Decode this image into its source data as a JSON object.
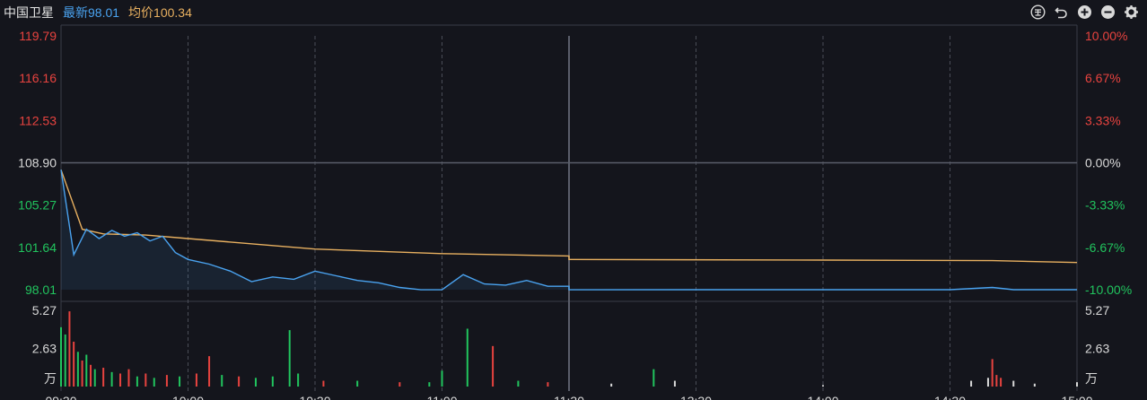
{
  "header": {
    "stock_name": "中国卫星",
    "latest_text": "最新98.01",
    "avg_text": "均价100.34"
  },
  "toolbar": [
    "history-icon",
    "undo-icon",
    "zoom-in-icon",
    "zoom-out-icon",
    "settings-icon"
  ],
  "colors": {
    "up": "#e8433f",
    "down": "#21c45e",
    "neutral": "#d9d9d9",
    "price_line": "#4aa3f0",
    "avg_line": "#e8b060",
    "background": "#14151c",
    "grid": "#3a3d47"
  },
  "chart_data": [
    {
      "type": "line",
      "series": [
        {
          "name": "最新",
          "x": [
            "09:30",
            "09:33",
            "09:36",
            "09:39",
            "09:42",
            "09:45",
            "09:48",
            "09:51",
            "09:54",
            "09:57",
            "10:00",
            "10:05",
            "10:10",
            "10:15",
            "10:20",
            "10:25",
            "10:30",
            "10:35",
            "10:40",
            "10:45",
            "10:50",
            "10:55",
            "11:00",
            "11:05",
            "11:10",
            "11:15",
            "11:20",
            "11:25",
            "11:30",
            "13:00",
            "13:30",
            "14:00",
            "14:30",
            "14:40",
            "14:45",
            "15:00"
          ],
          "values": [
            108.3,
            101.0,
            103.2,
            102.4,
            103.1,
            102.6,
            102.9,
            102.2,
            102.6,
            101.2,
            100.6,
            100.2,
            99.6,
            98.7,
            99.1,
            98.9,
            99.6,
            99.2,
            98.8,
            98.6,
            98.2,
            98.0,
            98.0,
            99.3,
            98.5,
            98.4,
            98.8,
            98.3,
            98.3,
            98.0,
            98.01,
            98.01,
            98.01,
            98.2,
            98.01,
            98.01
          ]
        },
        {
          "name": "均价",
          "x": [
            "09:30",
            "09:35",
            "09:40",
            "09:50",
            "10:00",
            "10:20",
            "10:30",
            "11:00",
            "11:30",
            "13:00",
            "14:00",
            "14:40",
            "15:00"
          ],
          "values": [
            108.3,
            103.2,
            102.8,
            102.7,
            102.4,
            101.8,
            101.5,
            101.1,
            100.9,
            100.6,
            100.55,
            100.5,
            100.34
          ]
        }
      ],
      "ylabel_left": [
        "119.79",
        "116.16",
        "112.53",
        "108.90",
        "105.27",
        "101.64",
        "98.01"
      ],
      "ylabel_right": [
        "10.00%",
        "6.67%",
        "3.33%",
        "0.00%",
        "-3.33%",
        "-6.67%",
        "-10.00%"
      ],
      "ylim": [
        98.01,
        119.79
      ],
      "prev_close": 108.9
    },
    {
      "type": "bar",
      "unit_label": "万",
      "ylabel_left": [
        "5.27",
        "2.63"
      ],
      "ylabel_right": [
        "5.27",
        "2.63"
      ],
      "ylim": [
        0,
        5.27
      ],
      "x_ticks": [
        "09:30",
        "10:00",
        "10:30",
        "11:00",
        "11:30",
        "13:30",
        "14:00",
        "14:30",
        "15:00"
      ],
      "bars": [
        {
          "t": "09:30",
          "v": 4.1,
          "d": "down"
        },
        {
          "t": "09:31",
          "v": 3.6,
          "d": "down"
        },
        {
          "t": "09:32",
          "v": 5.2,
          "d": "up"
        },
        {
          "t": "09:33",
          "v": 3.1,
          "d": "up"
        },
        {
          "t": "09:34",
          "v": 2.4,
          "d": "down"
        },
        {
          "t": "09:35",
          "v": 1.8,
          "d": "up"
        },
        {
          "t": "09:36",
          "v": 2.2,
          "d": "down"
        },
        {
          "t": "09:37",
          "v": 1.5,
          "d": "up"
        },
        {
          "t": "09:38",
          "v": 1.2,
          "d": "down"
        },
        {
          "t": "09:40",
          "v": 1.3,
          "d": "up"
        },
        {
          "t": "09:42",
          "v": 1.0,
          "d": "down"
        },
        {
          "t": "09:44",
          "v": 0.9,
          "d": "up"
        },
        {
          "t": "09:46",
          "v": 1.2,
          "d": "up"
        },
        {
          "t": "09:48",
          "v": 0.7,
          "d": "down"
        },
        {
          "t": "09:50",
          "v": 0.9,
          "d": "up"
        },
        {
          "t": "09:52",
          "v": 0.6,
          "d": "down"
        },
        {
          "t": "09:55",
          "v": 0.8,
          "d": "up"
        },
        {
          "t": "09:58",
          "v": 0.7,
          "d": "down"
        },
        {
          "t": "10:02",
          "v": 0.9,
          "d": "up"
        },
        {
          "t": "10:05",
          "v": 2.1,
          "d": "up"
        },
        {
          "t": "10:08",
          "v": 0.8,
          "d": "down"
        },
        {
          "t": "10:12",
          "v": 0.7,
          "d": "up"
        },
        {
          "t": "10:16",
          "v": 0.6,
          "d": "down"
        },
        {
          "t": "10:20",
          "v": 0.7,
          "d": "down"
        },
        {
          "t": "10:24",
          "v": 3.9,
          "d": "down"
        },
        {
          "t": "10:26",
          "v": 0.9,
          "d": "down"
        },
        {
          "t": "10:32",
          "v": 0.4,
          "d": "up"
        },
        {
          "t": "10:40",
          "v": 0.4,
          "d": "down"
        },
        {
          "t": "10:50",
          "v": 0.3,
          "d": "up"
        },
        {
          "t": "10:57",
          "v": 0.3,
          "d": "down"
        },
        {
          "t": "11:00",
          "v": 1.1,
          "d": "down"
        },
        {
          "t": "11:06",
          "v": 4.0,
          "d": "down"
        },
        {
          "t": "11:12",
          "v": 2.8,
          "d": "up"
        },
        {
          "t": "11:18",
          "v": 0.4,
          "d": "down"
        },
        {
          "t": "11:25",
          "v": 0.3,
          "d": "up"
        },
        {
          "t": "13:10",
          "v": 0.2,
          "d": "neutral"
        },
        {
          "t": "13:20",
          "v": 1.2,
          "d": "down"
        },
        {
          "t": "13:25",
          "v": 0.4,
          "d": "neutral"
        },
        {
          "t": "14:00",
          "v": 0.1,
          "d": "neutral"
        },
        {
          "t": "14:35",
          "v": 0.4,
          "d": "neutral"
        },
        {
          "t": "14:39",
          "v": 0.6,
          "d": "neutral"
        },
        {
          "t": "14:40",
          "v": 1.9,
          "d": "up"
        },
        {
          "t": "14:41",
          "v": 0.8,
          "d": "up"
        },
        {
          "t": "14:42",
          "v": 0.6,
          "d": "up"
        },
        {
          "t": "14:45",
          "v": 0.4,
          "d": "neutral"
        },
        {
          "t": "14:50",
          "v": 0.2,
          "d": "neutral"
        },
        {
          "t": "15:00",
          "v": 0.3,
          "d": "neutral"
        }
      ]
    }
  ]
}
